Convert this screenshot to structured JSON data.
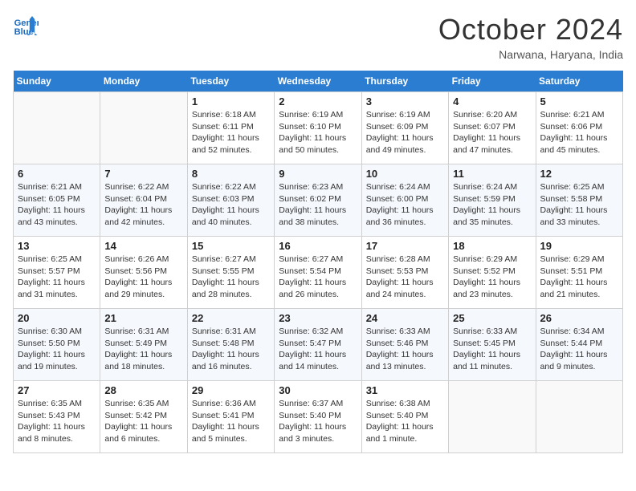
{
  "header": {
    "logo_line1": "General",
    "logo_line2": "Blue",
    "month_title": "October 2024",
    "location": "Narwana, Haryana, India"
  },
  "weekdays": [
    "Sunday",
    "Monday",
    "Tuesday",
    "Wednesday",
    "Thursday",
    "Friday",
    "Saturday"
  ],
  "weeks": [
    [
      null,
      null,
      {
        "day": 1,
        "sunrise": "6:18 AM",
        "sunset": "6:11 PM",
        "daylight": "11 hours and 52 minutes."
      },
      {
        "day": 2,
        "sunrise": "6:19 AM",
        "sunset": "6:10 PM",
        "daylight": "11 hours and 50 minutes."
      },
      {
        "day": 3,
        "sunrise": "6:19 AM",
        "sunset": "6:09 PM",
        "daylight": "11 hours and 49 minutes."
      },
      {
        "day": 4,
        "sunrise": "6:20 AM",
        "sunset": "6:07 PM",
        "daylight": "11 hours and 47 minutes."
      },
      {
        "day": 5,
        "sunrise": "6:21 AM",
        "sunset": "6:06 PM",
        "daylight": "11 hours and 45 minutes."
      }
    ],
    [
      {
        "day": 6,
        "sunrise": "6:21 AM",
        "sunset": "6:05 PM",
        "daylight": "11 hours and 43 minutes."
      },
      {
        "day": 7,
        "sunrise": "6:22 AM",
        "sunset": "6:04 PM",
        "daylight": "11 hours and 42 minutes."
      },
      {
        "day": 8,
        "sunrise": "6:22 AM",
        "sunset": "6:03 PM",
        "daylight": "11 hours and 40 minutes."
      },
      {
        "day": 9,
        "sunrise": "6:23 AM",
        "sunset": "6:02 PM",
        "daylight": "11 hours and 38 minutes."
      },
      {
        "day": 10,
        "sunrise": "6:24 AM",
        "sunset": "6:00 PM",
        "daylight": "11 hours and 36 minutes."
      },
      {
        "day": 11,
        "sunrise": "6:24 AM",
        "sunset": "5:59 PM",
        "daylight": "11 hours and 35 minutes."
      },
      {
        "day": 12,
        "sunrise": "6:25 AM",
        "sunset": "5:58 PM",
        "daylight": "11 hours and 33 minutes."
      }
    ],
    [
      {
        "day": 13,
        "sunrise": "6:25 AM",
        "sunset": "5:57 PM",
        "daylight": "11 hours and 31 minutes."
      },
      {
        "day": 14,
        "sunrise": "6:26 AM",
        "sunset": "5:56 PM",
        "daylight": "11 hours and 29 minutes."
      },
      {
        "day": 15,
        "sunrise": "6:27 AM",
        "sunset": "5:55 PM",
        "daylight": "11 hours and 28 minutes."
      },
      {
        "day": 16,
        "sunrise": "6:27 AM",
        "sunset": "5:54 PM",
        "daylight": "11 hours and 26 minutes."
      },
      {
        "day": 17,
        "sunrise": "6:28 AM",
        "sunset": "5:53 PM",
        "daylight": "11 hours and 24 minutes."
      },
      {
        "day": 18,
        "sunrise": "6:29 AM",
        "sunset": "5:52 PM",
        "daylight": "11 hours and 23 minutes."
      },
      {
        "day": 19,
        "sunrise": "6:29 AM",
        "sunset": "5:51 PM",
        "daylight": "11 hours and 21 minutes."
      }
    ],
    [
      {
        "day": 20,
        "sunrise": "6:30 AM",
        "sunset": "5:50 PM",
        "daylight": "11 hours and 19 minutes."
      },
      {
        "day": 21,
        "sunrise": "6:31 AM",
        "sunset": "5:49 PM",
        "daylight": "11 hours and 18 minutes."
      },
      {
        "day": 22,
        "sunrise": "6:31 AM",
        "sunset": "5:48 PM",
        "daylight": "11 hours and 16 minutes."
      },
      {
        "day": 23,
        "sunrise": "6:32 AM",
        "sunset": "5:47 PM",
        "daylight": "11 hours and 14 minutes."
      },
      {
        "day": 24,
        "sunrise": "6:33 AM",
        "sunset": "5:46 PM",
        "daylight": "11 hours and 13 minutes."
      },
      {
        "day": 25,
        "sunrise": "6:33 AM",
        "sunset": "5:45 PM",
        "daylight": "11 hours and 11 minutes."
      },
      {
        "day": 26,
        "sunrise": "6:34 AM",
        "sunset": "5:44 PM",
        "daylight": "11 hours and 9 minutes."
      }
    ],
    [
      {
        "day": 27,
        "sunrise": "6:35 AM",
        "sunset": "5:43 PM",
        "daylight": "11 hours and 8 minutes."
      },
      {
        "day": 28,
        "sunrise": "6:35 AM",
        "sunset": "5:42 PM",
        "daylight": "11 hours and 6 minutes."
      },
      {
        "day": 29,
        "sunrise": "6:36 AM",
        "sunset": "5:41 PM",
        "daylight": "11 hours and 5 minutes."
      },
      {
        "day": 30,
        "sunrise": "6:37 AM",
        "sunset": "5:40 PM",
        "daylight": "11 hours and 3 minutes."
      },
      {
        "day": 31,
        "sunrise": "6:38 AM",
        "sunset": "5:40 PM",
        "daylight": "11 hours and 1 minute."
      },
      null,
      null
    ]
  ]
}
